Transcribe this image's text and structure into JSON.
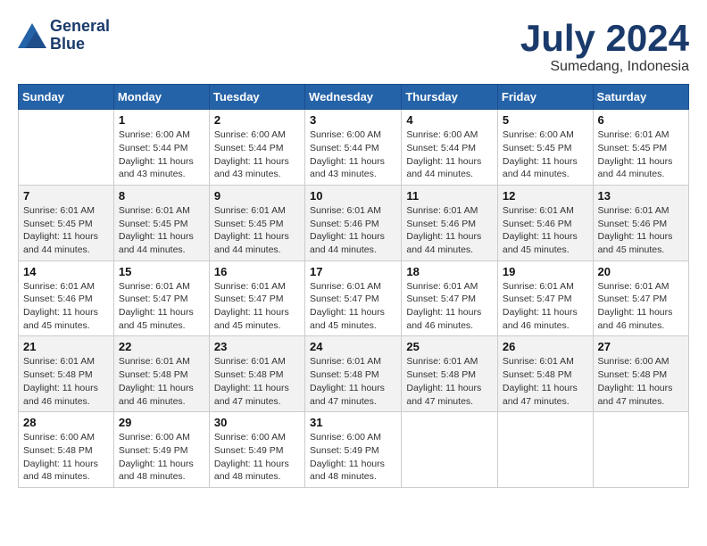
{
  "header": {
    "logo_line1": "General",
    "logo_line2": "Blue",
    "month": "July 2024",
    "location": "Sumedang, Indonesia"
  },
  "days_of_week": [
    "Sunday",
    "Monday",
    "Tuesday",
    "Wednesday",
    "Thursday",
    "Friday",
    "Saturday"
  ],
  "weeks": [
    [
      {
        "day": "",
        "info": ""
      },
      {
        "day": "1",
        "info": "Sunrise: 6:00 AM\nSunset: 5:44 PM\nDaylight: 11 hours\nand 43 minutes."
      },
      {
        "day": "2",
        "info": "Sunrise: 6:00 AM\nSunset: 5:44 PM\nDaylight: 11 hours\nand 43 minutes."
      },
      {
        "day": "3",
        "info": "Sunrise: 6:00 AM\nSunset: 5:44 PM\nDaylight: 11 hours\nand 43 minutes."
      },
      {
        "day": "4",
        "info": "Sunrise: 6:00 AM\nSunset: 5:44 PM\nDaylight: 11 hours\nand 44 minutes."
      },
      {
        "day": "5",
        "info": "Sunrise: 6:00 AM\nSunset: 5:45 PM\nDaylight: 11 hours\nand 44 minutes."
      },
      {
        "day": "6",
        "info": "Sunrise: 6:01 AM\nSunset: 5:45 PM\nDaylight: 11 hours\nand 44 minutes."
      }
    ],
    [
      {
        "day": "7",
        "info": "Sunrise: 6:01 AM\nSunset: 5:45 PM\nDaylight: 11 hours\nand 44 minutes."
      },
      {
        "day": "8",
        "info": "Sunrise: 6:01 AM\nSunset: 5:45 PM\nDaylight: 11 hours\nand 44 minutes."
      },
      {
        "day": "9",
        "info": "Sunrise: 6:01 AM\nSunset: 5:45 PM\nDaylight: 11 hours\nand 44 minutes."
      },
      {
        "day": "10",
        "info": "Sunrise: 6:01 AM\nSunset: 5:46 PM\nDaylight: 11 hours\nand 44 minutes."
      },
      {
        "day": "11",
        "info": "Sunrise: 6:01 AM\nSunset: 5:46 PM\nDaylight: 11 hours\nand 44 minutes."
      },
      {
        "day": "12",
        "info": "Sunrise: 6:01 AM\nSunset: 5:46 PM\nDaylight: 11 hours\nand 45 minutes."
      },
      {
        "day": "13",
        "info": "Sunrise: 6:01 AM\nSunset: 5:46 PM\nDaylight: 11 hours\nand 45 minutes."
      }
    ],
    [
      {
        "day": "14",
        "info": "Sunrise: 6:01 AM\nSunset: 5:46 PM\nDaylight: 11 hours\nand 45 minutes."
      },
      {
        "day": "15",
        "info": "Sunrise: 6:01 AM\nSunset: 5:47 PM\nDaylight: 11 hours\nand 45 minutes."
      },
      {
        "day": "16",
        "info": "Sunrise: 6:01 AM\nSunset: 5:47 PM\nDaylight: 11 hours\nand 45 minutes."
      },
      {
        "day": "17",
        "info": "Sunrise: 6:01 AM\nSunset: 5:47 PM\nDaylight: 11 hours\nand 45 minutes."
      },
      {
        "day": "18",
        "info": "Sunrise: 6:01 AM\nSunset: 5:47 PM\nDaylight: 11 hours\nand 46 minutes."
      },
      {
        "day": "19",
        "info": "Sunrise: 6:01 AM\nSunset: 5:47 PM\nDaylight: 11 hours\nand 46 minutes."
      },
      {
        "day": "20",
        "info": "Sunrise: 6:01 AM\nSunset: 5:47 PM\nDaylight: 11 hours\nand 46 minutes."
      }
    ],
    [
      {
        "day": "21",
        "info": "Sunrise: 6:01 AM\nSunset: 5:48 PM\nDaylight: 11 hours\nand 46 minutes."
      },
      {
        "day": "22",
        "info": "Sunrise: 6:01 AM\nSunset: 5:48 PM\nDaylight: 11 hours\nand 46 minutes."
      },
      {
        "day": "23",
        "info": "Sunrise: 6:01 AM\nSunset: 5:48 PM\nDaylight: 11 hours\nand 47 minutes."
      },
      {
        "day": "24",
        "info": "Sunrise: 6:01 AM\nSunset: 5:48 PM\nDaylight: 11 hours\nand 47 minutes."
      },
      {
        "day": "25",
        "info": "Sunrise: 6:01 AM\nSunset: 5:48 PM\nDaylight: 11 hours\nand 47 minutes."
      },
      {
        "day": "26",
        "info": "Sunrise: 6:01 AM\nSunset: 5:48 PM\nDaylight: 11 hours\nand 47 minutes."
      },
      {
        "day": "27",
        "info": "Sunrise: 6:00 AM\nSunset: 5:48 PM\nDaylight: 11 hours\nand 47 minutes."
      }
    ],
    [
      {
        "day": "28",
        "info": "Sunrise: 6:00 AM\nSunset: 5:48 PM\nDaylight: 11 hours\nand 48 minutes."
      },
      {
        "day": "29",
        "info": "Sunrise: 6:00 AM\nSunset: 5:49 PM\nDaylight: 11 hours\nand 48 minutes."
      },
      {
        "day": "30",
        "info": "Sunrise: 6:00 AM\nSunset: 5:49 PM\nDaylight: 11 hours\nand 48 minutes."
      },
      {
        "day": "31",
        "info": "Sunrise: 6:00 AM\nSunset: 5:49 PM\nDaylight: 11 hours\nand 48 minutes."
      },
      {
        "day": "",
        "info": ""
      },
      {
        "day": "",
        "info": ""
      },
      {
        "day": "",
        "info": ""
      }
    ]
  ]
}
